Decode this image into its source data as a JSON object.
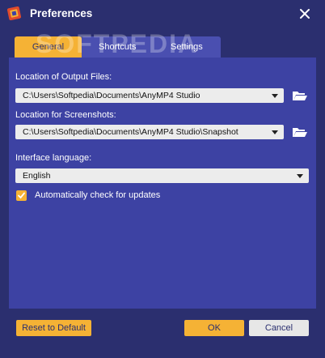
{
  "window": {
    "title": "Preferences",
    "app_icon": "anymp4-logo-icon",
    "close_icon": "close-icon",
    "watermark": "SOFTPEDIA"
  },
  "tabs": [
    {
      "label": "General",
      "active": true
    },
    {
      "label": "Shortcuts",
      "active": false
    },
    {
      "label": "Settings",
      "active": false
    }
  ],
  "general": {
    "output_files": {
      "label": "Location of Output Files:",
      "value": "C:\\Users\\Softpedia\\Documents\\AnyMP4 Studio",
      "folder_icon": "folder-open-icon"
    },
    "screenshots": {
      "label": "Location for Screenshots:",
      "value": "C:\\Users\\Softpedia\\Documents\\AnyMP4 Studio\\Snapshot",
      "folder_icon": "folder-open-icon"
    },
    "language": {
      "label": "Interface language:",
      "value": "English"
    },
    "auto_update": {
      "label": "Automatically check for updates",
      "checked": true
    }
  },
  "buttons": {
    "reset": "Reset to Default",
    "ok": "OK",
    "cancel": "Cancel"
  },
  "colors": {
    "background": "#2b2f6f",
    "panel": "#3d42a3",
    "accent": "#f5b235",
    "inactive_tab": "#4a4fb0"
  }
}
